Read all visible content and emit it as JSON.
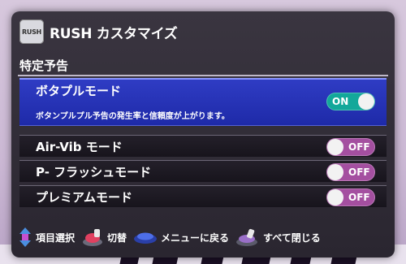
{
  "header": {
    "logo_text": "RUSH",
    "title": "RUSH カスタマイズ"
  },
  "section": {
    "title": "特定予告"
  },
  "options": [
    {
      "label": "ボタプルモード",
      "description": "ボタンプルプル予告の発生率と信頼度が上がります。",
      "state": "ON",
      "selected": true
    },
    {
      "label": "Air-Vib モード",
      "state": "OFF",
      "selected": false
    },
    {
      "label": "P- フラッシュモード",
      "state": "OFF",
      "selected": false
    },
    {
      "label": "プレミアムモード",
      "state": "OFF",
      "selected": false
    }
  ],
  "footer": {
    "hints": [
      {
        "icon": "dpad-updown-icon",
        "label": "項目選択"
      },
      {
        "icon": "push-button-icon",
        "label": "切替"
      },
      {
        "icon": "blue-button-icon",
        "label": "メニューに戻る"
      },
      {
        "icon": "lever-button-icon",
        "label": "すべて閉じる"
      }
    ]
  },
  "colors": {
    "selected_row": "#2633b8",
    "toggle_on": "#13a89a",
    "toggle_off": "#a44fa0"
  }
}
